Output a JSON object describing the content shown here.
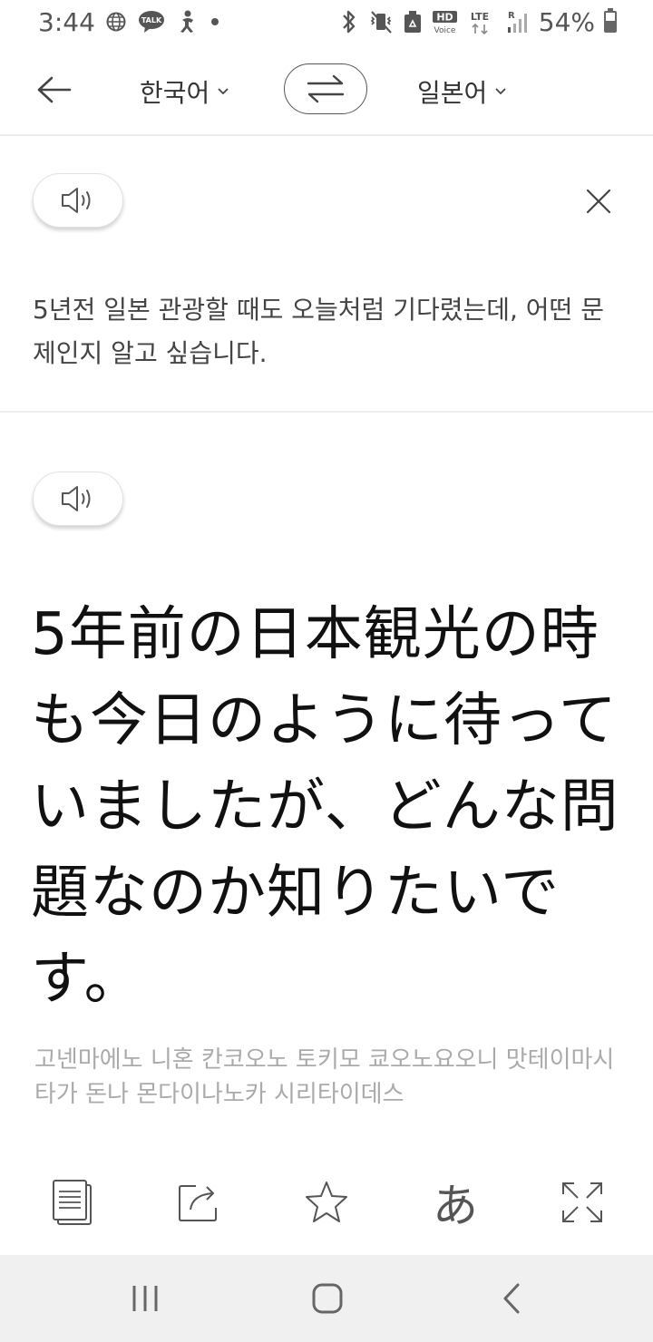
{
  "status_bar": {
    "time": "3:44",
    "left_icons": [
      "globe-icon",
      "talk-icon",
      "accessibility-icon",
      "dot-icon"
    ],
    "talk_label": "TALK",
    "right_icons": [
      "bluetooth-icon",
      "vibrate-icon",
      "recycle-icon",
      "hd-voice-icon",
      "lte-icon",
      "signal-icon",
      "battery-icon"
    ],
    "hd_label": "HD",
    "voice_label": "Voice",
    "lte_label": "LTE",
    "roaming_label": "R",
    "battery_percent": 54,
    "battery_text": "54%"
  },
  "toolbar": {
    "back_icon": "arrow-left-icon",
    "source_language": "한국어",
    "target_language": "일본어",
    "swap_icon": "swap-arrows-icon",
    "dropdown_icon": "chevron-down-icon"
  },
  "source": {
    "speaker_icon": "speaker-icon",
    "close_icon": "close-icon",
    "text": "5년전 일본 관광할 때도 오늘처럼 기다렸는데, 어떤 문제인지 알고 싶습니다."
  },
  "result": {
    "speaker_icon": "speaker-icon",
    "text": "5年前の日本観光の時も今日のように待っていましたが、どんな問題なのか知りたいです。",
    "pronunciation": "고넨마에노 니혼 칸코오노 토키모 쿄오노요오니 맛테이마시타가 돈나 몬다이나노카 시리타이데스"
  },
  "actions": {
    "items": [
      "copy-icon",
      "share-icon",
      "star-icon",
      "kana-icon",
      "expand-icon"
    ],
    "kana_label": "あ"
  },
  "navbar": {
    "items": [
      "recent-apps-icon",
      "home-icon",
      "back-icon"
    ]
  },
  "colors": {
    "background": "#ffffff",
    "divider": "#ececec",
    "primary_text": "#111111",
    "secondary_text": "#444444",
    "muted_text": "#aaaaaa",
    "navbar_bg": "#f0f0f0"
  }
}
